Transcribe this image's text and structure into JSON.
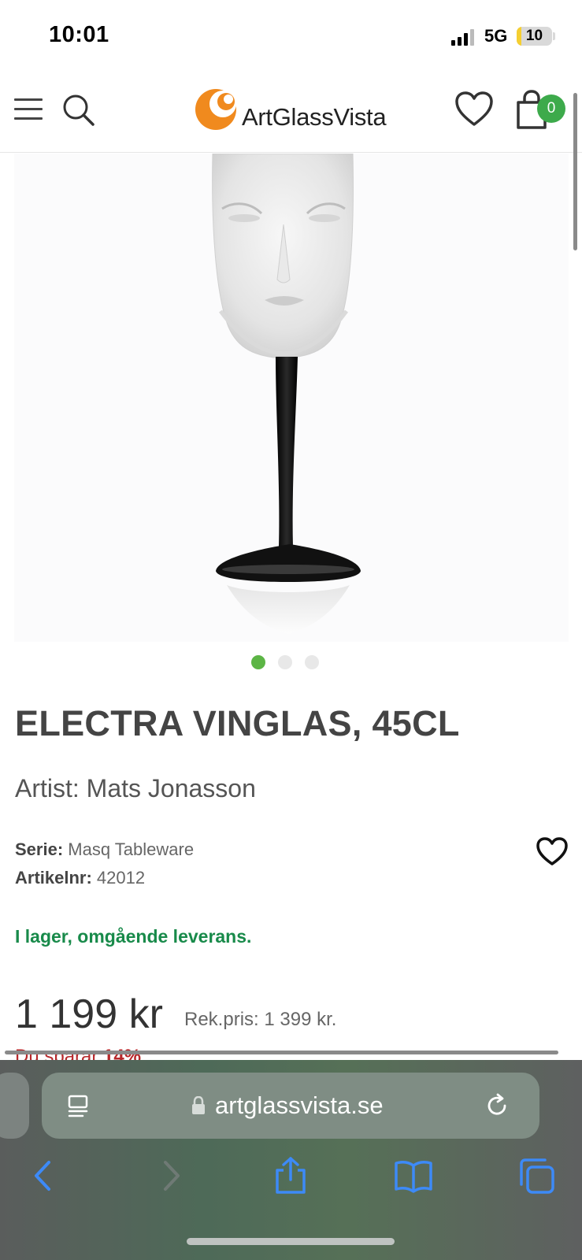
{
  "status_bar": {
    "time": "10:01",
    "network": "5G",
    "battery_level": "10",
    "signal_bars": 3,
    "signal_icon": "cellular-signal-icon"
  },
  "header": {
    "brand": "ArtGlassVista",
    "cart_count": "0",
    "menu_icon": "hamburger-icon",
    "search_icon": "search-icon",
    "wishlist_icon": "heart-icon",
    "cart_icon": "shopping-bag-icon",
    "brand_color": "#f08a1e",
    "badge_color": "#3daa4b"
  },
  "gallery": {
    "image_alt": "Electra vinglas - wine glass with frosted face bowl and black stem",
    "slides": 3,
    "active_slide": 1
  },
  "product": {
    "title": "ELECTRA VINGLAS, 45CL",
    "artist": "Artist: Mats Jonasson",
    "serie_label": "Serie:",
    "serie_value": "Masq Tableware",
    "article_label": "Artikelnr:",
    "article_value": "42012",
    "stock": "I lager, omgående leverans.",
    "price": "1 199 kr",
    "rrp": "Rek.pris:  1 399 kr.",
    "save_label": "Du sparar",
    "save_value": "14%",
    "stock_color": "#188a4a",
    "save_color": "#b7272a"
  },
  "safari": {
    "url": "artglassvista.se",
    "toolbar": [
      "back-icon",
      "forward-icon",
      "share-icon",
      "bookmarks-icon",
      "tabs-icon"
    ]
  }
}
